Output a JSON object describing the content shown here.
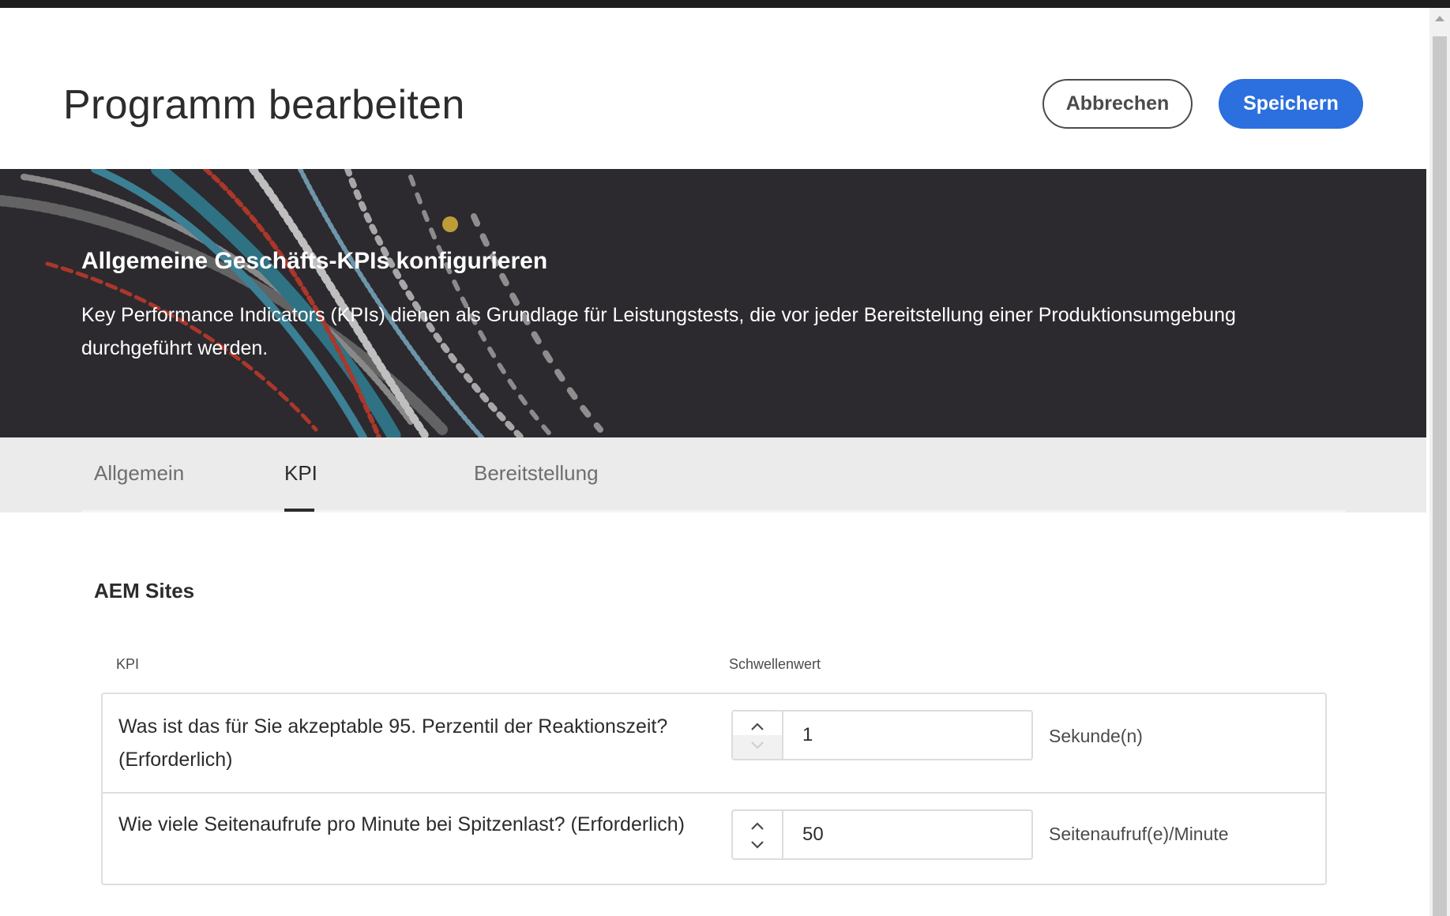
{
  "header": {
    "title": "Programm bearbeiten",
    "cancel_label": "Abbrechen",
    "save_label": "Speichern"
  },
  "hero": {
    "title": "Allgemeine Geschäfts-KPIs konfigurieren",
    "description": "Key Performance Indicators (KPIs) dienen als Grundlage für Leistungstests, die vor jeder Bereitstellung einer Produktionsumgebung durchgeführt werden."
  },
  "tabs": [
    {
      "label": "Allgemein",
      "active": false
    },
    {
      "label": "KPI",
      "active": true
    },
    {
      "label": "Bereitstellung",
      "active": false
    }
  ],
  "section": {
    "title": "AEM Sites",
    "columns": {
      "kpi": "KPI",
      "threshold": "Schwellenwert"
    },
    "rows": [
      {
        "question": "Was ist das für Sie akzeptable 95. Perzentil der Reaktionszeit? (Erforderlich)",
        "value": "1",
        "unit": "Sekunde(n)",
        "decrement_disabled": true
      },
      {
        "question": "Wie viele Seitenaufrufe pro Minute bei Spitzenlast? (Erforderlich)",
        "value": "50",
        "unit": "Seitenaufruf(e)/Minute",
        "decrement_disabled": false
      }
    ]
  },
  "colors": {
    "primary_button": "#2c6fde",
    "hero_background": "#2c2a2e",
    "tabs_background": "#ebebeb"
  },
  "icons": [
    "chevron-up-icon",
    "chevron-down-icon"
  ]
}
